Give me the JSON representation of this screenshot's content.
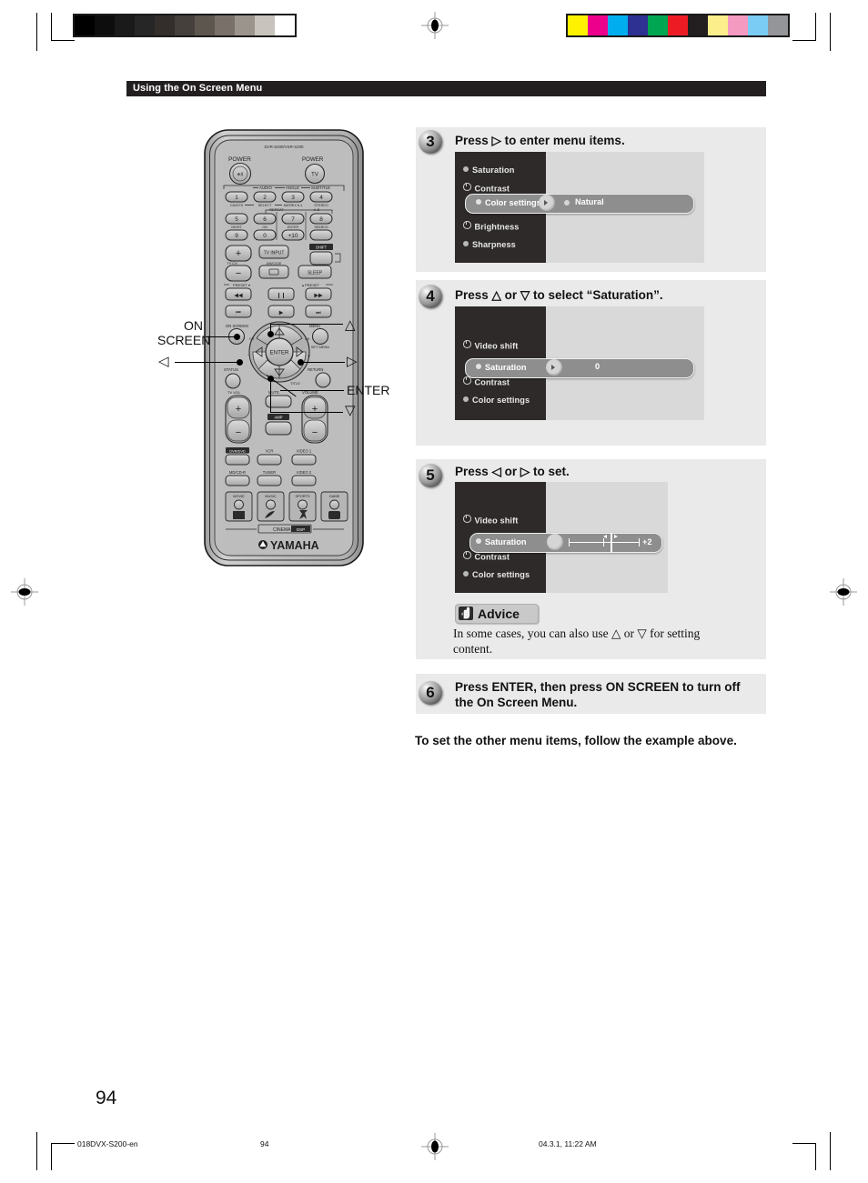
{
  "page": {
    "header_title": "Using the On Screen Menu",
    "page_number": "94",
    "closing_note": "To set the other menu items, follow the example above."
  },
  "footer": {
    "file_name": "018DVX-S200-en",
    "folio": "94",
    "timestamp": "04.3.1, 11:22 AM"
  },
  "remote": {
    "model_label": "DVR-S200/VSR-S200",
    "brand": "YAMAHA",
    "cinema_dsp": "CINEMA DSP",
    "callouts": [
      {
        "id": "on-screen",
        "label_line1": "ON",
        "label_line2": "SCREEN"
      },
      {
        "id": "up",
        "label": "△"
      },
      {
        "id": "left",
        "label": "◁"
      },
      {
        "id": "right",
        "label": "▷"
      },
      {
        "id": "enter",
        "label": "ENTER"
      },
      {
        "id": "down",
        "label": "▽"
      }
    ],
    "buttons": {
      "power_main": "POWER",
      "power_tv": "POWER",
      "power_tv_sub": "TV",
      "numbers": [
        "1",
        "2",
        "3",
        "4",
        "5",
        "6",
        "7",
        "8",
        "9",
        "0"
      ],
      "row_labels_top": [
        "AUDIO",
        "ANGLE",
        "SUBTITLE"
      ],
      "num_sublabels": [
        "CD/DTS",
        "SELECT",
        "MATRIX 6.1",
        "STEREO",
        "NIGHT",
        "ON",
        "ENTER",
        "SEARCH",
        "",
        "+10"
      ],
      "repeat": "REPEAT",
      "ab": "A-B",
      "tv_input": "TV INPUT",
      "tv_ch": "TV CH",
      "abcde": "A/B/C/D/E",
      "sleep": "SLEEP",
      "preset_down": "PRESET",
      "preset_up": "PRESET",
      "on_screen": "ON SCREEN",
      "menu": "MENU",
      "setmenu": "SET MENU",
      "status": "STATUS",
      "return": "RETURN",
      "enter": "ENTER",
      "title": "TITLE",
      "tv_vol": "TV VOL",
      "mute": "MUTE",
      "volume": "VOLUME",
      "amp": "AMP",
      "source_row1": [
        "DVR/DVD",
        "VCR",
        "VIDEO 1"
      ],
      "source_row2": [
        "MD/CD-R",
        "TUNER",
        "VIDEO 2"
      ],
      "dsp_row": [
        "MOVIE",
        "MUSIC",
        "SPORTS",
        "GAME"
      ]
    }
  },
  "steps": [
    {
      "number": "3",
      "title": "Press ▷ to enter menu items.",
      "osd": {
        "items": [
          {
            "label": "Saturation",
            "icon": "bullet"
          },
          {
            "label": "Contrast",
            "icon": "gear"
          },
          {
            "label": "Color settings",
            "icon": "bullet",
            "selected": true
          },
          {
            "label": "Brightness",
            "icon": "gear"
          },
          {
            "label": "Sharpness",
            "icon": "bullet"
          }
        ],
        "submenu_value": "Natural",
        "submenu_kind": "option"
      }
    },
    {
      "number": "4",
      "title": "Press △ or ▽ to select “Saturation”.",
      "osd": {
        "items": [
          {
            "label": "Video shift",
            "icon": "gear"
          },
          {
            "label": "Saturation",
            "icon": "bullet",
            "selected": true
          },
          {
            "label": "Contrast",
            "icon": "gear"
          },
          {
            "label": "Color settings",
            "icon": "bullet"
          }
        ],
        "submenu_value": "0",
        "submenu_kind": "value"
      }
    },
    {
      "number": "5",
      "title": "Press ◁ or ▷ to set.",
      "osd": {
        "items": [
          {
            "label": "Video shift",
            "icon": "gear"
          },
          {
            "label": "Saturation",
            "icon": "bullet",
            "selected": true
          },
          {
            "label": "Contrast",
            "icon": "gear"
          },
          {
            "label": "Color settings",
            "icon": "bullet"
          }
        ],
        "submenu_value": "+2",
        "submenu_kind": "slider"
      }
    },
    {
      "number": "6",
      "title_line1": "Press ENTER, then press ON SCREEN to turn off",
      "title_line2": "the On Screen Menu."
    }
  ],
  "advice": {
    "label": "Advice",
    "text": "In some cases, you can also use △ or ▽ for setting content."
  },
  "colors": {
    "header_bg": "#231f20",
    "panel_bg": "#eaeaea",
    "osd_bg": "#d9d9d9",
    "osd_left": "#2e2a29",
    "highlight": "#8e8e8e",
    "remote_body": "#b4b4b4",
    "registration_swatches": [
      "#fff200",
      "#ec008c",
      "#00aeef",
      "#2e3192",
      "#00a651",
      "#ed1c24",
      "#231f20",
      "#fdee8c",
      "#f49ac1",
      "#7accf4",
      "#939598"
    ],
    "gray_ramp": [
      "#000000",
      "#0d0d0d",
      "#1a1a1a",
      "#262626",
      "#332e2b",
      "#45403c",
      "#5c564f",
      "#787069",
      "#9b948c",
      "#c8c3bd",
      "#ffffff"
    ]
  }
}
